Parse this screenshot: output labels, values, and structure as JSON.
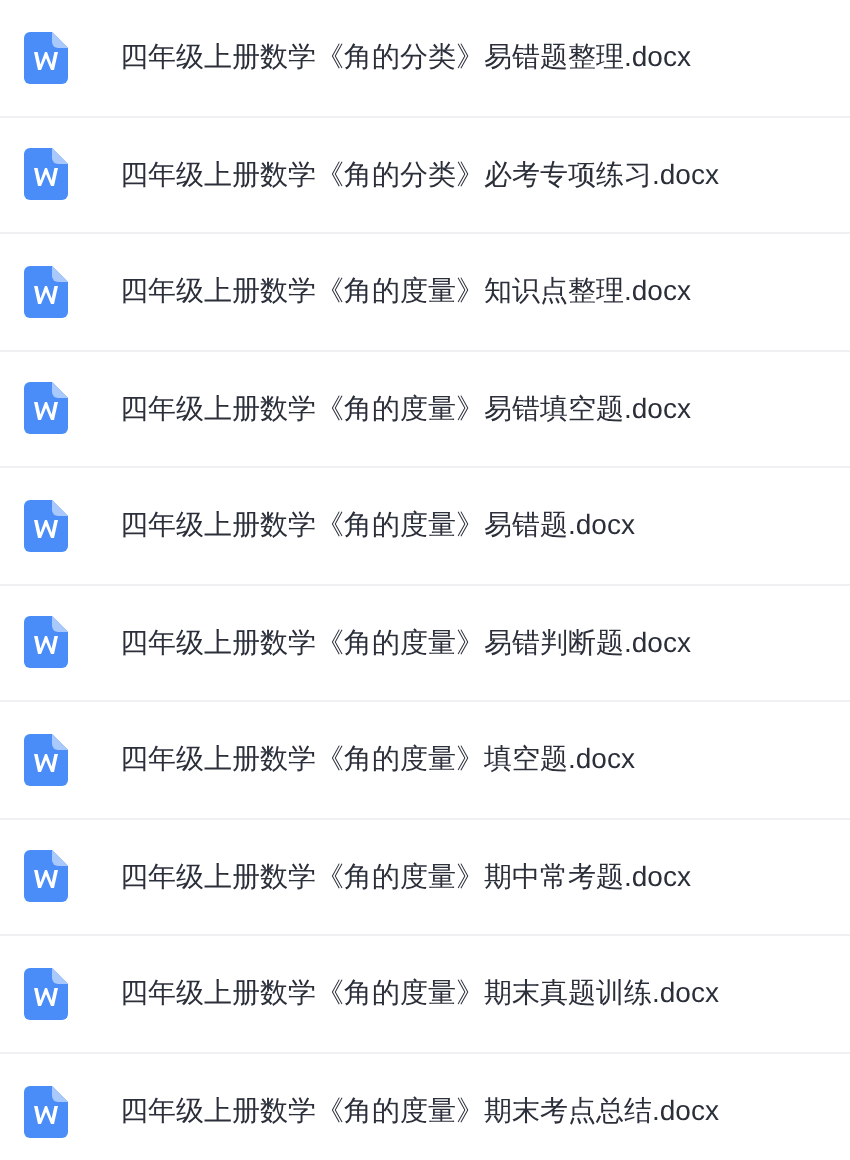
{
  "files": [
    {
      "name": "四年级上册数学《角的分类》易错题整理.docx"
    },
    {
      "name": "四年级上册数学《角的分类》必考专项练习.docx"
    },
    {
      "name": "四年级上册数学《角的度量》知识点整理.docx"
    },
    {
      "name": "四年级上册数学《角的度量》易错填空题.docx"
    },
    {
      "name": "四年级上册数学《角的度量》易错题.docx"
    },
    {
      "name": "四年级上册数学《角的度量》易错判断题.docx"
    },
    {
      "name": "四年级上册数学《角的度量》填空题.docx"
    },
    {
      "name": "四年级上册数学《角的度量》期中常考题.docx"
    },
    {
      "name": "四年级上册数学《角的度量》期末真题训练.docx"
    },
    {
      "name": "四年级上册数学《角的度量》期末考点总结.docx"
    }
  ]
}
